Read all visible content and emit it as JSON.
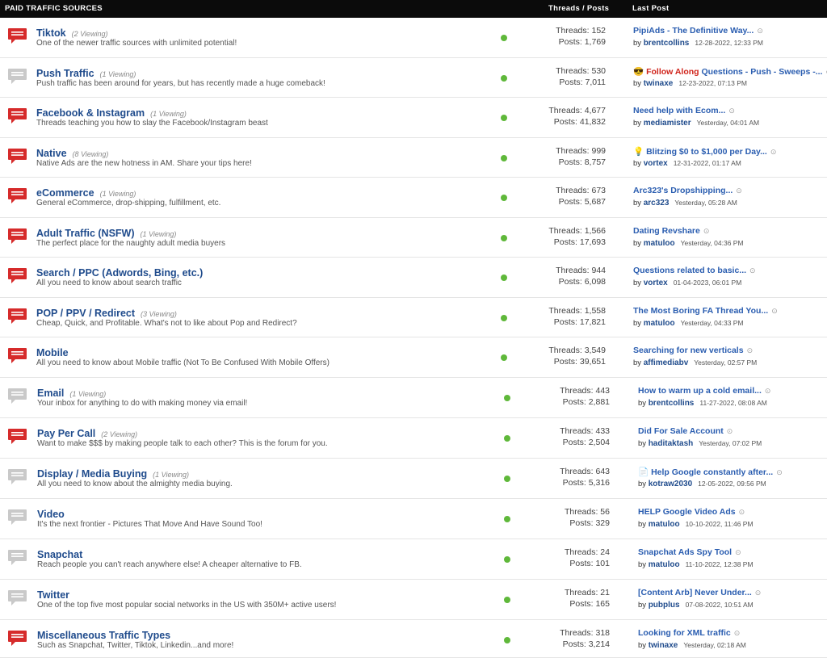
{
  "header": {
    "title": "PAID TRAFFIC SOURCES",
    "threads_posts": "Threads / Posts",
    "last_post": "Last Post"
  },
  "colors": {
    "header_bg": "#0b0b0b",
    "forum_title": "#1f4b8c",
    "new_posts_icon": "#d62b2b",
    "no_new_posts_icon": "#c9c9c9",
    "status_dot": "#5fb83a",
    "highlight_text": "#d0241b"
  },
  "forums": [
    {
      "title": "Tiktok",
      "viewing": "(2 Viewing)",
      "desc": "One of the newer traffic sources with unlimited potential!",
      "unread": true,
      "threads": "Threads: 152",
      "posts": "Posts: 1,769",
      "last_prefix": "",
      "last_highlight": "",
      "last_title": "PipiAds - The Definitive Way...",
      "last_user": "brentcollins",
      "last_date": "12-28-2022, 12:33 PM"
    },
    {
      "title": "Push Traffic",
      "viewing": "(1 Viewing)",
      "desc": "Push traffic has been around for years, but has recently made a huge comeback!",
      "unread": false,
      "threads": "Threads: 530",
      "posts": "Posts: 7,011",
      "last_prefix": "😎",
      "last_highlight": "Follow Along",
      "last_title": "Questions - Push - Sweeps -...",
      "last_user": "twinaxe",
      "last_date": "12-23-2022, 07:13 PM"
    },
    {
      "title": "Facebook & Instagram",
      "viewing": "(1 Viewing)",
      "desc": "Threads teaching you how to slay the Facebook/Instagram beast",
      "unread": true,
      "threads": "Threads: 4,677",
      "posts": "Posts: 41,832",
      "last_prefix": "",
      "last_highlight": "",
      "last_title": "Need help with Ecom...",
      "last_user": "mediamister",
      "last_date": "Yesterday, 04:01 AM"
    },
    {
      "title": "Native",
      "viewing": "(8 Viewing)",
      "desc": "Native Ads are the new hotness in AM. Share your tips here!",
      "unread": true,
      "threads": "Threads: 999",
      "posts": "Posts: 8,757",
      "last_prefix": "💡",
      "last_highlight": "",
      "last_title": "Blitzing $0 to $1,000 per Day...",
      "last_user": "vortex",
      "last_date": "12-31-2022, 01:17 AM"
    },
    {
      "title": "eCommerce",
      "viewing": "(1 Viewing)",
      "desc": "General eCommerce, drop-shipping, fulfillment, etc.",
      "unread": true,
      "threads": "Threads: 673",
      "posts": "Posts: 5,687",
      "last_prefix": "",
      "last_highlight": "",
      "last_title": "Arc323's Dropshipping...",
      "last_user": "arc323",
      "last_date": "Yesterday, 05:28 AM"
    },
    {
      "title": "Adult Traffic (NSFW)",
      "viewing": "(1 Viewing)",
      "desc": "The perfect place for the naughty adult media buyers",
      "unread": true,
      "threads": "Threads: 1,566",
      "posts": "Posts: 17,693",
      "last_prefix": "",
      "last_highlight": "",
      "last_title": "Dating Revshare",
      "last_user": "matuloo",
      "last_date": "Yesterday, 04:36 PM"
    },
    {
      "title": "Search / PPC (Adwords, Bing, etc.)",
      "viewing": "",
      "desc": "All you need to know about search traffic",
      "unread": true,
      "threads": "Threads: 944",
      "posts": "Posts: 6,098",
      "last_prefix": "",
      "last_highlight": "",
      "last_title": "Questions related to basic...",
      "last_user": "vortex",
      "last_date": "01-04-2023, 06:01 PM"
    },
    {
      "title": "POP / PPV / Redirect",
      "viewing": "(3 Viewing)",
      "desc": "Cheap, Quick, and Profitable. What's not to like about Pop and Redirect?",
      "unread": true,
      "threads": "Threads: 1,558",
      "posts": "Posts: 17,821",
      "last_prefix": "",
      "last_highlight": "",
      "last_title": "The Most Boring FA Thread You...",
      "last_user": "matuloo",
      "last_date": "Yesterday, 04:33 PM"
    },
    {
      "title": "Mobile",
      "viewing": "",
      "desc": "All you need to know about Mobile traffic (Not To Be Confused With Mobile Offers)",
      "unread": true,
      "threads": "Threads: 3,549",
      "posts": "Posts: 39,651",
      "last_prefix": "",
      "last_highlight": "",
      "last_title": "Searching for new verticals",
      "last_user": "affimediabv",
      "last_date": "Yesterday, 02:57 PM"
    },
    {
      "title": "Email",
      "viewing": "(1 Viewing)",
      "desc": "Your inbox for anything to do with making money via email!",
      "unread": false,
      "threads": "Threads: 443",
      "posts": "Posts: 2,881",
      "last_prefix": "",
      "last_highlight": "",
      "last_title": "How to warm up a cold email...",
      "last_user": "brentcollins",
      "last_date": "11-27-2022, 08:08 AM"
    },
    {
      "title": "Pay Per Call",
      "viewing": "(2 Viewing)",
      "desc": "Want to make $$$ by making people talk to each other? This is the forum for you.",
      "unread": true,
      "threads": "Threads: 433",
      "posts": "Posts: 2,504",
      "last_prefix": "",
      "last_highlight": "",
      "last_title": "Did For Sale Account",
      "last_user": "haditaktash",
      "last_date": "Yesterday, 07:02 PM"
    },
    {
      "title": "Display / Media Buying",
      "viewing": "(1 Viewing)",
      "desc": "All you need to know about the almighty media buying.",
      "unread": false,
      "threads": "Threads: 643",
      "posts": "Posts: 5,316",
      "last_prefix": "📄",
      "last_highlight": "",
      "last_title": "Help Google constantly after...",
      "last_user": "kotraw2030",
      "last_date": "12-05-2022, 09:56 PM"
    },
    {
      "title": "Video",
      "viewing": "",
      "desc": "It's the next frontier - Pictures That Move And Have Sound Too!",
      "unread": false,
      "threads": "Threads: 56",
      "posts": "Posts: 329",
      "last_prefix": "",
      "last_highlight": "",
      "last_title": "HELP Google Video Ads",
      "last_user": "matuloo",
      "last_date": "10-10-2022, 11:46 PM"
    },
    {
      "title": "Snapchat",
      "viewing": "",
      "desc": "Reach people you can't reach anywhere else! A cheaper alternative to FB.",
      "unread": false,
      "threads": "Threads: 24",
      "posts": "Posts: 101",
      "last_prefix": "",
      "last_highlight": "",
      "last_title": "Snapchat Ads Spy Tool",
      "last_user": "matuloo",
      "last_date": "11-10-2022, 12:38 PM"
    },
    {
      "title": "Twitter",
      "viewing": "",
      "desc": "One of the top five most popular social networks in the US with 350M+ active users!",
      "unread": false,
      "threads": "Threads: 21",
      "posts": "Posts: 165",
      "last_prefix": "",
      "last_highlight": "",
      "last_title": "[Content Arb] Never Under...",
      "last_user": "pubplus",
      "last_date": "07-08-2022, 10:51 AM"
    },
    {
      "title": "Miscellaneous Traffic Types",
      "viewing": "",
      "desc": "Such as Snapchat, Twitter, Tiktok, Linkedin...and more!",
      "unread": true,
      "threads": "Threads: 318",
      "posts": "Posts: 3,214",
      "last_prefix": "",
      "last_highlight": "",
      "last_title": "Looking for XML traffic",
      "last_user": "twinaxe",
      "last_date": "Yesterday, 02:18 AM"
    }
  ]
}
